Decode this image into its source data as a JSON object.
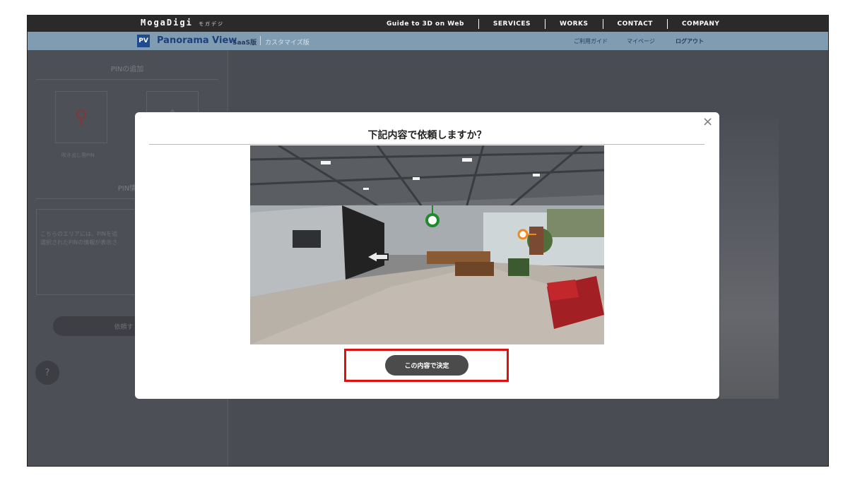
{
  "header": {
    "brand": "MogaDigi",
    "brand_ruby": "モガデジ",
    "nav": [
      "Guide to 3D on Web",
      "SERVICES",
      "WORKS",
      "CONTACT",
      "COMPANY"
    ]
  },
  "subheader": {
    "logo": "PV",
    "title": "Panorama View",
    "saas": "SaaS版",
    "custom": "カスタマイズ版",
    "links": [
      "ご利用ガイド",
      "マイページ",
      "ログアウト"
    ]
  },
  "left_panel": {
    "add_pin_title": "PINの追加",
    "pin_label_1": "吹き出し用PIN",
    "pin_info_title": "PIN情",
    "info_text_line1": "こちらのエリアには、PINを追",
    "info_text_line2": "選択されたPINの情報が表示さ",
    "request_button": "依頼す",
    "help_icon": "?"
  },
  "modal": {
    "title": "下記内容で依頼しますか？",
    "close_label": "×",
    "confirm_button": "この内容で決定"
  },
  "colors": {
    "topbar": "#2a2a2a",
    "subbar": "#7f9cb3",
    "overlay": "#4a4c54",
    "highlight": "#e01010",
    "pin_green": "#1f8a2e",
    "pin_orange": "#f08a1c"
  }
}
